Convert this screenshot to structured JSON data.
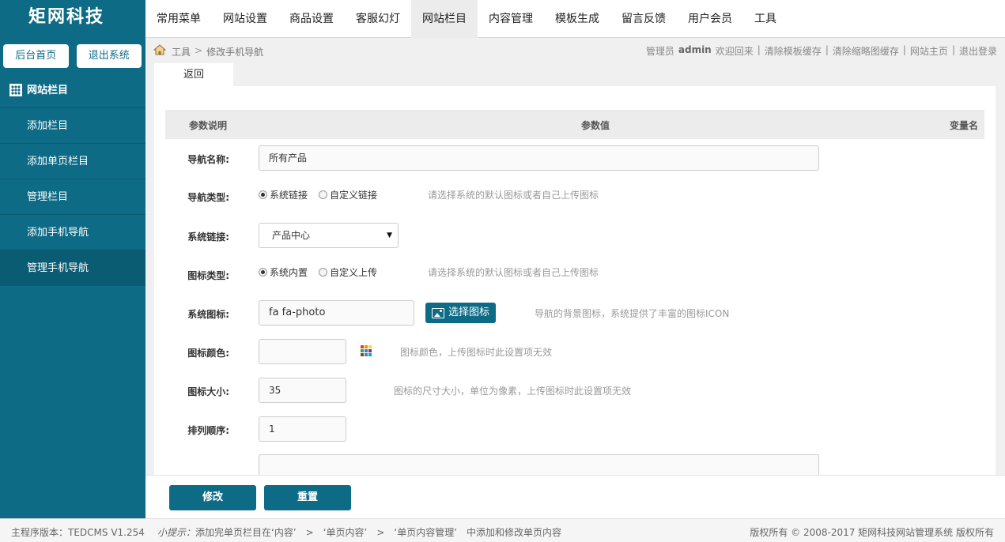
{
  "brand": {
    "name": "矩网科技"
  },
  "topnav": [
    "常用菜单",
    "网站设置",
    "商品设置",
    "客服幻灯",
    "网站栏目",
    "内容管理",
    "模板生成",
    "留言反馈",
    "用户会员",
    "工具"
  ],
  "sidebar": {
    "home_btn": "后台首页",
    "logout_btn": "退出系统",
    "section": "网站栏目",
    "items": [
      "添加栏目",
      "添加单页栏目",
      "管理栏目",
      "添加手机导航",
      "管理手机导航"
    ]
  },
  "breadcrumb": {
    "root": "工具",
    "sep": ">",
    "current": "修改手机导航"
  },
  "admin": {
    "role": "管理员",
    "name": "admin",
    "welcome": "欢迎回来",
    "sep": "|",
    "links": [
      "清除模板缓存",
      "清除缩略图缓存",
      "网站主页",
      "退出登录"
    ]
  },
  "tab": {
    "back": "返回"
  },
  "table_head": {
    "desc": "参数说明",
    "value": "参数值",
    "var": "变量名"
  },
  "form": {
    "nav_name": {
      "label": "导航名称:",
      "value": "所有产品"
    },
    "nav_type": {
      "label": "导航类型:",
      "opt1": "系统链接",
      "opt2": "自定义链接",
      "hint": "请选择系统的默认图标或者自己上传图标"
    },
    "sys_link": {
      "label": "系统链接:",
      "value": "产品中心",
      "caret": "▼"
    },
    "icon_type": {
      "label": "图标类型:",
      "opt1": "系统内置",
      "opt2": "自定义上传",
      "hint": "请选择系统的默认图标或者自己上传图标"
    },
    "sys_icon": {
      "label": "系统图标:",
      "value": "fa fa-photo",
      "button": "选择图标",
      "hint": "导航的背景图标，系统提供了丰富的图标ICON"
    },
    "icon_color": {
      "label": "图标颜色:",
      "value": "",
      "hint": "图标颜色，上传图标时此设置项无效"
    },
    "icon_size": {
      "label": "图标大小:",
      "value": "35",
      "hint": "图标的尺寸大小，单位为像素，上传图标时此设置项无效"
    },
    "sort": {
      "label": "排列顺序:",
      "value": "1"
    }
  },
  "actions": {
    "submit": "修改",
    "reset": "重置"
  },
  "footer": {
    "version": "主程序版本：TEDCMS V1.254",
    "tip_label": "小提示：",
    "tip_text": "添加完单页栏目在‘内容’　>　‘单页内容’　>　‘单页内容管理’　中添加和修改单页内容",
    "copyright": "版权所有 © 2008-2017 矩网科技网站管理系统 版权所有"
  },
  "colors": {
    "primary": "#0d6b86",
    "sidebar_active": "#0a5c73"
  }
}
